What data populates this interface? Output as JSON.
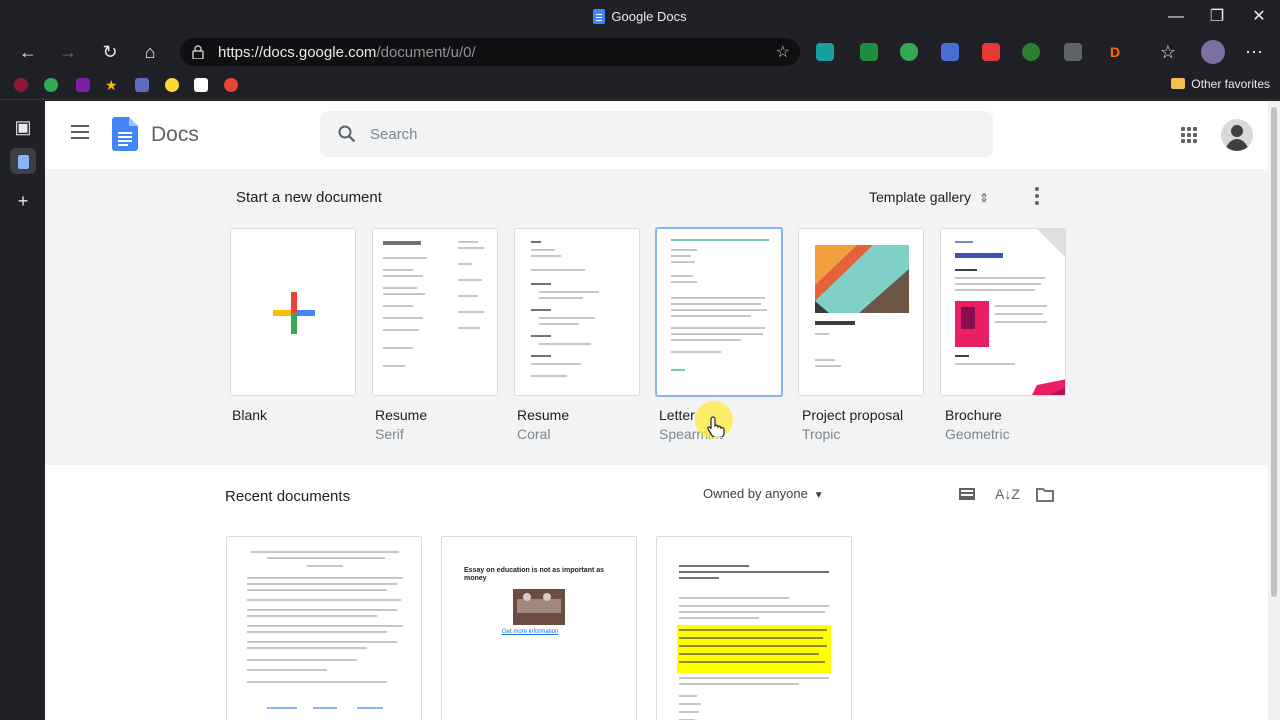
{
  "window": {
    "title": "Google Docs"
  },
  "browser": {
    "url_host": "https://docs.google.com",
    "url_path": "/document/u/0/",
    "other_favorites": "Other favorites"
  },
  "header": {
    "app_name": "Docs",
    "search_placeholder": "Search"
  },
  "templates": {
    "section_title": "Start a new document",
    "gallery_label": "Template gallery",
    "items": [
      {
        "name": "Blank",
        "sub": ""
      },
      {
        "name": "Resume",
        "sub": "Serif"
      },
      {
        "name": "Resume",
        "sub": "Coral"
      },
      {
        "name": "Letter",
        "sub": "Spearmint"
      },
      {
        "name": "Project proposal",
        "sub": "Tropic"
      },
      {
        "name": "Brochure",
        "sub": "Geometric"
      }
    ]
  },
  "recent": {
    "section_title": "Recent documents",
    "owner_filter": "Owned by anyone",
    "docs": [
      {
        "heading": ""
      },
      {
        "heading": "Essay on education is not as important as money",
        "link": "Get more information"
      },
      {
        "heading": ""
      }
    ]
  },
  "colors": {
    "docs_blue": "#4285f4",
    "plus_red": "#ea4335",
    "plus_yellow": "#fbbc04",
    "plus_green": "#34a853",
    "highlight": "#ffff00"
  }
}
